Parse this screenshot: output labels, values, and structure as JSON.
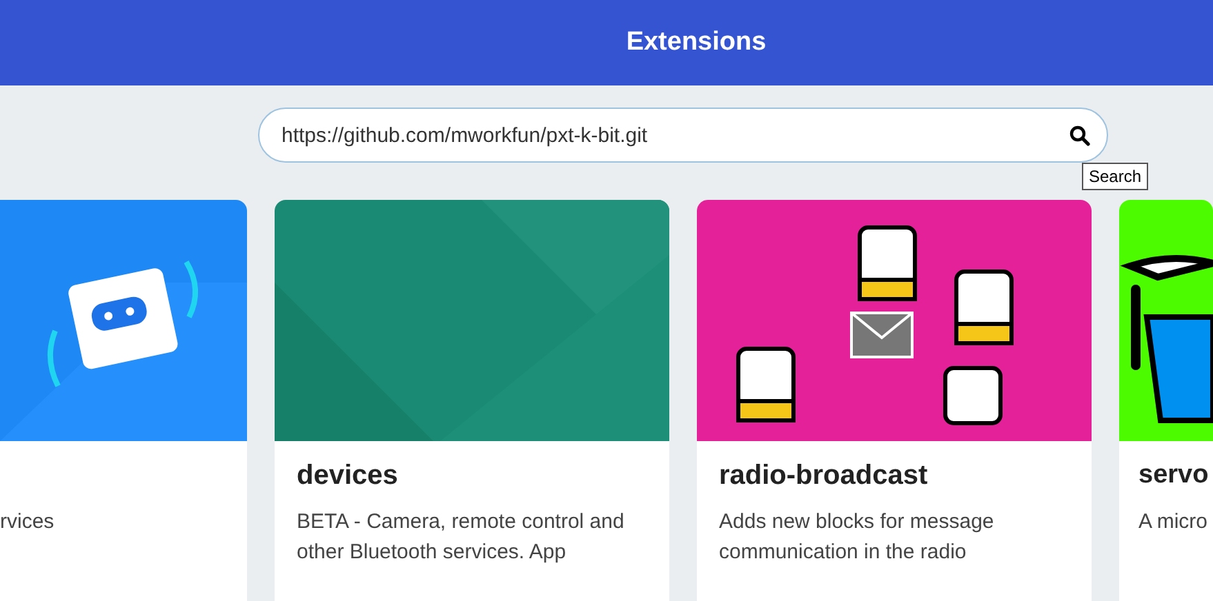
{
  "header": {
    "title": "Extensions"
  },
  "search": {
    "value": "https://github.com/mworkfun/pxt-k-bit.git",
    "tooltip": "Search"
  },
  "cards": [
    {
      "kind": "robot",
      "description": "rvices"
    },
    {
      "kind": "pattern",
      "title": "devices",
      "description": "BETA - Camera, remote control and other Bluetooth services. App"
    },
    {
      "kind": "characters",
      "title": "radio-broadcast",
      "description": "Adds new blocks for message communication in the radio"
    },
    {
      "kind": "bucket",
      "title": "servo",
      "description": "A micro"
    }
  ]
}
